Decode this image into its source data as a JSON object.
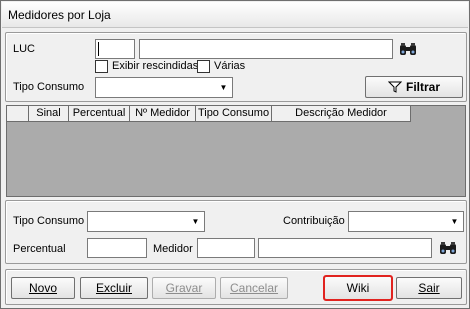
{
  "window": {
    "title": "Medidores por Loja"
  },
  "filter": {
    "luc_label": "LUC",
    "luc_code_value": "",
    "luc_desc_value": "",
    "exibir_rescindidas_label": "Exibir rescindidas",
    "exibir_rescindidas_checked": false,
    "varias_label": "Várias",
    "varias_checked": false,
    "tipo_consumo_label": "Tipo Consumo",
    "tipo_consumo_value": "",
    "filtrar_label": "Filtrar"
  },
  "grid": {
    "columns": [
      "",
      "Sinal",
      "Percentual",
      "Nº Medidor",
      "Tipo Consumo",
      "Descrição Medidor"
    ],
    "rows": []
  },
  "edit": {
    "tipo_consumo_label": "Tipo Consumo",
    "tipo_consumo_value": "",
    "contribuicao_label": "Contribuição",
    "contribuicao_value": "",
    "percentual_label": "Percentual",
    "percentual_value": "",
    "medidor_label": "Medidor",
    "medidor_code_value": "",
    "medidor_desc_value": ""
  },
  "buttons": {
    "novo": "Novo",
    "excluir": "Excluir",
    "gravar": "Gravar",
    "cancelar": "Cancelar",
    "wiki": "Wiki",
    "sair": "Sair"
  },
  "icons": {
    "search": "binoculars-icon",
    "filter": "funnel-icon"
  },
  "colors": {
    "highlight": "#e1231f",
    "grid_background": "#ababab"
  }
}
